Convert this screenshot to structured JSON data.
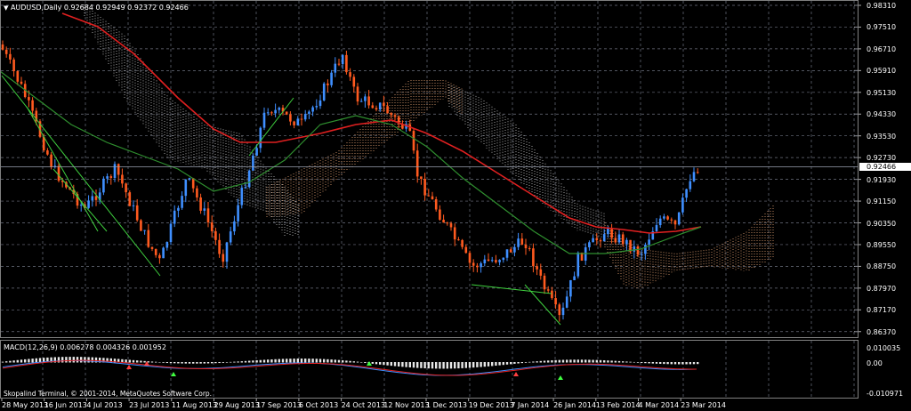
{
  "window": {
    "title": "AUDUSD,Daily",
    "ohlc": "0.92684 0.92949 0.92372 0.92466"
  },
  "price_axis": {
    "labels": [
      "0.98310",
      "0.97510",
      "0.96710",
      "0.95910",
      "0.95130",
      "0.94330",
      "0.93530",
      "0.92730",
      "0.91930",
      "0.91150",
      "0.90350",
      "0.89550",
      "0.88750",
      "0.87970",
      "0.87170",
      "0.86370"
    ],
    "current": "0.92466"
  },
  "macd": {
    "title": "MACD(12,26,9) 0.006278 0.004326 0.001952",
    "axis": [
      "0.010035",
      "0.00",
      "-0.010971"
    ]
  },
  "time_axis": {
    "labels": [
      "28 May 2013",
      "16 Jun 2013",
      "4 Jul 2013",
      "23 Jul 2013",
      "11 Aug 2013",
      "29 Aug 2013",
      "17 Sep 2013",
      "6 Oct 2013",
      "24 Oct 2013",
      "12 Nov 2013",
      "1 Dec 2013",
      "19 Dec 2013",
      "7 Jan 2014",
      "26 Jan 2014",
      "13 Feb 2014",
      "4 Mar 2014",
      "23 Mar 2014"
    ]
  },
  "footer": {
    "copyright": "Skopalind Terminal, © 2001-2014, MetaQuotes Software Corp."
  },
  "colors": {
    "background": "#000000",
    "grid": "#6e7280",
    "bull": "#3f8fff",
    "bear": "#ff5a1f",
    "ma_slow": "#e02020",
    "ma_fast": "#2f8f2f",
    "cloud_gray": "#c0c0c0",
    "cloud_orange": "#e3a070"
  }
}
